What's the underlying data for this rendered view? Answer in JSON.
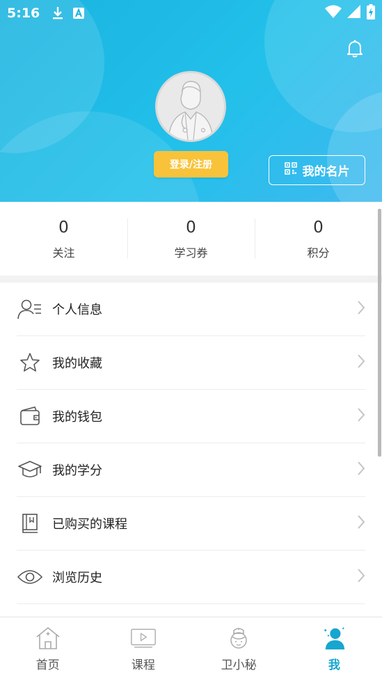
{
  "status_bar": {
    "time": "5:16"
  },
  "profile": {
    "login_label": "登录/注册",
    "card_label": "我的名片"
  },
  "stats": [
    {
      "value": "0",
      "label": "关注"
    },
    {
      "value": "0",
      "label": "学习券"
    },
    {
      "value": "0",
      "label": "积分"
    }
  ],
  "menu": [
    {
      "icon": "person-info-icon",
      "label": "个人信息"
    },
    {
      "icon": "star-icon",
      "label": "我的收藏"
    },
    {
      "icon": "wallet-icon",
      "label": "我的钱包"
    },
    {
      "icon": "graduation-cap-icon",
      "label": "我的学分"
    },
    {
      "icon": "book-icon",
      "label": "已购买的课程"
    },
    {
      "icon": "eye-icon",
      "label": "浏览历史"
    }
  ],
  "tabs": [
    {
      "icon": "home-icon",
      "label": "首页"
    },
    {
      "icon": "video-icon",
      "label": "课程"
    },
    {
      "icon": "nurse-icon",
      "label": "卫小秘"
    },
    {
      "icon": "me-icon",
      "label": "我",
      "active": true
    }
  ],
  "colors": {
    "header": "#1ab3e0",
    "login_button": "#f8c33a",
    "active_tab": "#16a6d0"
  }
}
